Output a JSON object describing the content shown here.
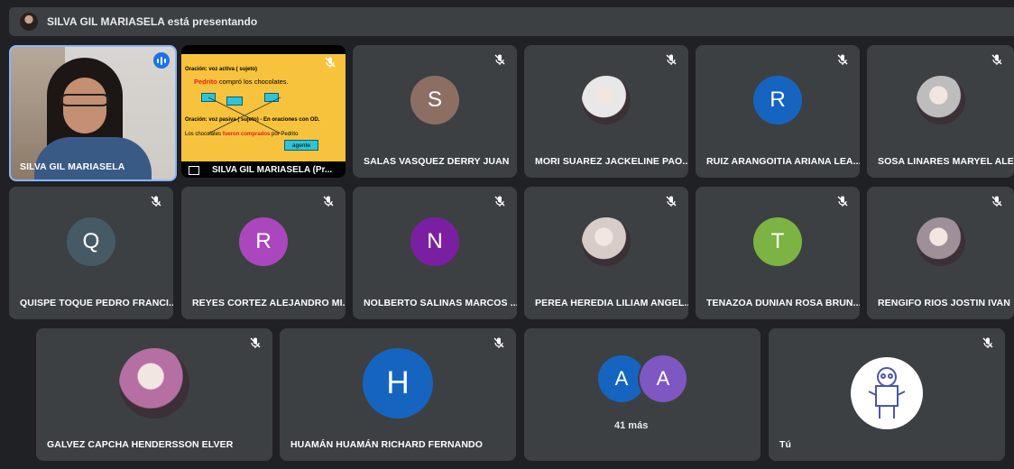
{
  "topbar": {
    "text": "SILVA GIL MARIASELA está presentando"
  },
  "presenter": {
    "name": "SILVA GIL MARIASELA"
  },
  "presentation": {
    "name": "SILVA GIL MARIASELA (Pr...",
    "line1": "Oración: voz activa ( sujeto)",
    "line2a": "Pedrito",
    "line2b": " compró los chocolates.",
    "line3": "Oración: voz pasiva  ( sujeto) - En oraciones con OD.",
    "line4a": "Los chocolates ",
    "line4b": "fueron comprados",
    "line4c": " por Pedrito",
    "agent": "agente"
  },
  "participants": [
    {
      "name": "SALAS VASQUEZ DERRY JUAN",
      "initial": "S",
      "color": "#8d6e63"
    },
    {
      "name": "MORI SUAREZ JACKELINE PAO...",
      "initial": "",
      "color": "#e8e8e8"
    },
    {
      "name": "RUIZ ARANGOITIA ARIANA LEA...",
      "initial": "R",
      "color": "#1565c0"
    },
    {
      "name": "SOSA LINARES MARYEL ALEXA...",
      "initial": "",
      "color": "#bdbdbd"
    },
    {
      "name": "QUISPE TOQUE PEDRO FRANCI...",
      "initial": "Q",
      "color": "#455a64"
    },
    {
      "name": "REYES CORTEZ ALEJANDRO MI...",
      "initial": "R",
      "color": "#ab47bc"
    },
    {
      "name": "NOLBERTO SALINAS MARCOS ...",
      "initial": "N",
      "color": "#7b1fa2"
    },
    {
      "name": "PEREA HEREDIA LILIAM ANGEL...",
      "initial": "",
      "color": "#d7ccc8"
    },
    {
      "name": "TENAZOA DUNIAN ROSA BRUN...",
      "initial": "T",
      "color": "#7cb342"
    },
    {
      "name": "RENGIFO RIOS JOSTIN IVAN",
      "initial": "",
      "color": "#9e8f99"
    },
    {
      "name": "GALVEZ CAPCHA HENDERSSON ELVER",
      "initial": "",
      "color": "#b56fa3"
    },
    {
      "name": "HUAMÁN HUAMÁN RICHARD FERNANDO",
      "initial": "H",
      "color": "#1565c0"
    }
  ],
  "more": {
    "initial1": "A",
    "color1": "#1565c0",
    "initial2": "A",
    "color2": "#7e57c2",
    "label": "41 más"
  },
  "self": {
    "name": "Tú"
  },
  "icons": {
    "mute": "mic-off-icon",
    "speaking": "audio-level-icon"
  }
}
